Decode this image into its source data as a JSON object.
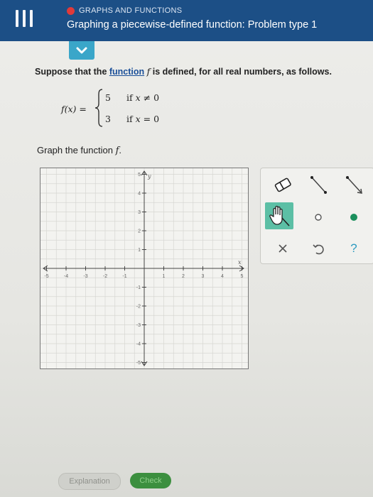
{
  "header": {
    "topic": "GRAPHS AND FUNCTIONS",
    "title": "Graphing a piecewise-defined function: Problem type 1"
  },
  "question": {
    "prefix": "Suppose that the ",
    "link": "function",
    "func_name": "f",
    "suffix": " is defined, for all real numbers, as follows."
  },
  "piecewise": {
    "lhs": "f(x) =",
    "cases": [
      {
        "value": "5",
        "condition_var": "x",
        "condition_rest": " ≠ 0"
      },
      {
        "value": "3",
        "condition_var": "x",
        "condition_rest": " = 0"
      }
    ]
  },
  "instruction": {
    "prefix": "Graph the function ",
    "func_name": "f",
    "suffix": "."
  },
  "graph": {
    "x_label": "x",
    "y_label": "y",
    "x_ticks": [
      "-5",
      "-4",
      "-3",
      "-2",
      "-1",
      "1",
      "2",
      "3",
      "4",
      "5"
    ],
    "y_ticks": [
      "5",
      "4",
      "3",
      "2",
      "1",
      "-1",
      "-2",
      "-3",
      "-4",
      "-5"
    ],
    "x_range": [
      -5,
      5
    ],
    "y_range": [
      -5,
      5
    ]
  },
  "toolbox": {
    "tools": [
      "eraser-icon",
      "segment-icon",
      "ray-icon",
      "hand-icon",
      "open-point-icon",
      "closed-point-icon",
      "clear-icon",
      "undo-icon",
      "help-icon"
    ],
    "selected": "hand-icon",
    "help_label": "?"
  },
  "buttons": {
    "explanation": "Explanation",
    "check": "Check"
  },
  "colors": {
    "header": "#1c4f86",
    "accent": "#3aa6c9",
    "selected_tool": "#5cbfa5",
    "check": "#3c8f3f",
    "topic_dot": "#e03a3a"
  }
}
